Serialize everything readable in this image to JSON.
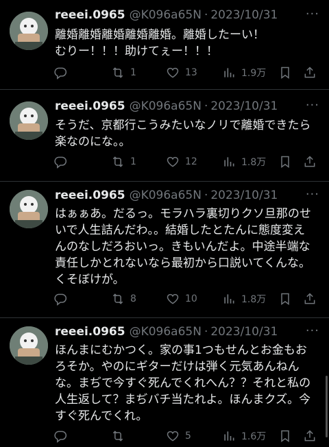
{
  "tweets": [
    {
      "name": "reeei.0965",
      "handle": "@K096a65N",
      "date": "2023/10/31",
      "lines": [
        "離婚離婚離婚離婚離婚。離婚したーい！",
        "むりー！！！助けてぇー！！！"
      ],
      "replies": "",
      "retweets": "1",
      "likes": "13",
      "views": "1.9万"
    },
    {
      "name": "reeei.0965",
      "handle": "@K096a65N",
      "date": "2023/10/31",
      "lines": [
        "そうだ、京都行こうみたいなノリで離婚できたら",
        "楽なのにな。。"
      ],
      "replies": "",
      "retweets": "1",
      "likes": "12",
      "views": "1.8万"
    },
    {
      "name": "reeei.0965",
      "handle": "@K096a65N",
      "date": "2023/10/31",
      "lines": [
        "はぁぁあ。だるっ。モラハラ裏切りクソ旦那のせ",
        "いで人生詰んだわ。。結婚したとたんに態度変え",
        "んのなしだろおいっ。きもいんだよ。中途半端な",
        "責任しかとれないなら最初から口説いてくんな。",
        "くそぼけが。"
      ],
      "replies": "",
      "retweets": "8",
      "likes": "10",
      "views": "1.8万"
    },
    {
      "name": "reeei.0965",
      "handle": "@K096a65N",
      "date": "2023/10/31",
      "lines": [
        "ほんまにむかつく。家の事1つもせんとお金もお",
        "ろそか。やのにギターだけは弾く元気あんねん",
        "な。まぢで今すぐ死んでくれへん？？それと私の",
        "人生返して？まぢバチ当たれよ。ほんまクズ。今",
        "すぐ死んでくれ。"
      ],
      "replies": "",
      "retweets": "",
      "likes": "5",
      "views": "1.6万"
    }
  ],
  "separator": "·",
  "more_label": "···"
}
